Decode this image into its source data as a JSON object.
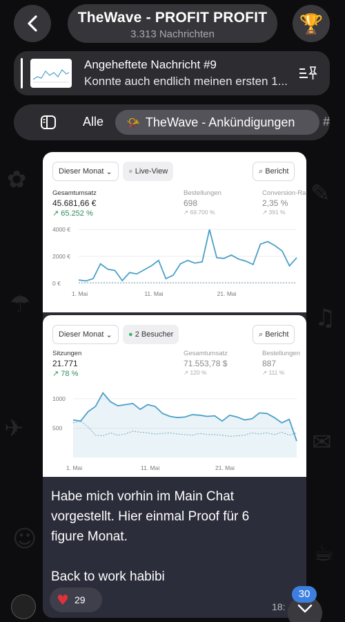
{
  "header": {
    "title": "TheWave - PROFIT PROFIT",
    "subtitle": "3.313 Nachrichten",
    "avatar_icon": "trophy-icon"
  },
  "pinned": {
    "title": "Angeheftete Nachricht #9",
    "preview": "Konnte auch endlich meinen ersten 1..."
  },
  "tabs": {
    "items": [
      {
        "label": "Alle"
      },
      {
        "label": "TheWave - Ankündigungen",
        "icon": "megaphone-icon",
        "active": true
      }
    ],
    "more": "#"
  },
  "screenshot1": {
    "period": "Dieser Monat",
    "live": "Live-View",
    "report": "Bericht",
    "kpis": [
      {
        "label": "Gesamtumsatz",
        "value": "45.681,66 €",
        "change": "↗ 65.252 %"
      },
      {
        "label": "Bestellungen",
        "value": "698",
        "change": "↗ 69.700 %"
      },
      {
        "label": "Conversion-Ra",
        "value": "2,35 %",
        "change": "↗ 391 %"
      }
    ]
  },
  "screenshot2": {
    "period": "Dieser Monat",
    "visitors": "2 Besucher",
    "report": "Bericht",
    "kpis": [
      {
        "label": "Sitzungen",
        "value": "21.771",
        "change": "↗ 78 %"
      },
      {
        "label": "Gesamtumsatz",
        "value": "71.553,78 $",
        "change": "↗ 120 %"
      },
      {
        "label": "Bestellungen",
        "value": "887",
        "change": "↗ 111 %"
      }
    ]
  },
  "chart_data": [
    {
      "type": "line",
      "x": [
        1,
        2,
        3,
        4,
        5,
        6,
        7,
        8,
        9,
        10,
        11,
        12,
        13,
        14,
        15,
        16,
        17,
        18,
        19,
        20,
        21,
        22,
        23,
        24,
        25,
        26,
        27,
        28,
        29,
        30,
        31
      ],
      "series": [
        {
          "values": [
            250,
            180,
            350,
            1450,
            1050,
            950,
            200,
            800,
            700,
            1000,
            1300,
            1700,
            350,
            600,
            1450,
            1700,
            1500,
            1600,
            4000,
            1900,
            1850,
            2100,
            1800,
            1650,
            1400,
            2900,
            3100,
            2800,
            2400,
            1300,
            1900
          ]
        },
        {
          "values": [
            50,
            50,
            50,
            50,
            50,
            50,
            50,
            50,
            50,
            50,
            50,
            50,
            50,
            50,
            50,
            50,
            50,
            50,
            50,
            50,
            50,
            50,
            50,
            50,
            50,
            50,
            50,
            50,
            50,
            50,
            50
          ]
        }
      ],
      "yticks": [
        "4000 €",
        "2000 €",
        "0 €"
      ],
      "ylim": [
        0,
        4000
      ],
      "xticks": [
        "1. Mai",
        "11. Mai",
        "21. Mai"
      ]
    },
    {
      "type": "area",
      "x": [
        1,
        2,
        3,
        4,
        5,
        6,
        7,
        8,
        9,
        10,
        11,
        12,
        13,
        14,
        15,
        16,
        17,
        18,
        19,
        20,
        21,
        22,
        23,
        24,
        25,
        26,
        27,
        28,
        29,
        30,
        31
      ],
      "series": [
        {
          "values": [
            640,
            620,
            780,
            870,
            1100,
            950,
            880,
            900,
            920,
            820,
            900,
            870,
            750,
            700,
            680,
            690,
            730,
            720,
            700,
            710,
            620,
            720,
            690,
            640,
            660,
            760,
            750,
            680,
            590,
            650,
            280
          ]
        },
        {
          "values": [
            590,
            620,
            520,
            380,
            370,
            420,
            380,
            400,
            450,
            430,
            420,
            400,
            410,
            420,
            400,
            390,
            380,
            410,
            390,
            390,
            380,
            360,
            370,
            380,
            420,
            400,
            420,
            390,
            430,
            380,
            420
          ]
        }
      ],
      "yticks": [
        "1000",
        "500"
      ],
      "ylim": [
        0,
        1200
      ],
      "xticks": [
        "1. Mai",
        "11. Mai",
        "21. Mai"
      ]
    }
  ],
  "message": {
    "text": "Habe mich vorhin im Main Chat\nvorgestellt. Hier einmal Proof für 6\nfigure Monat.\n\nBack to work habibi",
    "reaction_count": "29",
    "time": "18:",
    "unread_badge": "30"
  },
  "colors": {
    "line": "#4a9fc8",
    "up": "#2e8b57",
    "badge": "#3d7fe0",
    "heart": "#e0323a"
  }
}
